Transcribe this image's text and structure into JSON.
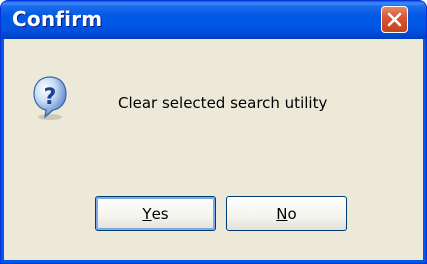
{
  "window": {
    "title": "Confirm",
    "close_icon": "close-icon"
  },
  "dialog": {
    "icon": "question-icon",
    "message": "Clear selected search utility"
  },
  "buttons": {
    "yes": {
      "mnemonic": "Y",
      "rest": "es"
    },
    "no": {
      "mnemonic": "N",
      "rest": "o"
    }
  },
  "colors": {
    "titlebar": "#0058e6",
    "client_background": "#ece9d8",
    "close_button": "#d9532e",
    "button_border": "#003c74"
  }
}
